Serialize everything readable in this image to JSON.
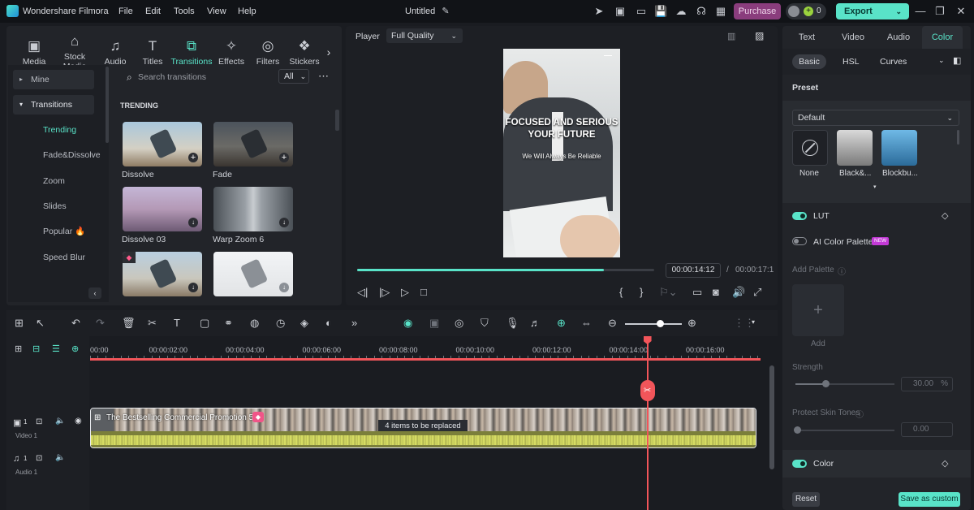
{
  "app": {
    "name": "Wondershare Filmora",
    "project": "Untitled"
  },
  "menu": [
    "File",
    "Edit",
    "Tools",
    "View",
    "Help"
  ],
  "titlebar": {
    "purchase": "Purchase",
    "credits": "0",
    "export": "Export"
  },
  "media_tabs": [
    {
      "label": "Media",
      "icon": "media-icon"
    },
    {
      "label": "Stock Media",
      "icon": "stock-media-icon"
    },
    {
      "label": "Audio",
      "icon": "audio-icon"
    },
    {
      "label": "Titles",
      "icon": "titles-icon"
    },
    {
      "label": "Transitions",
      "icon": "transitions-icon"
    },
    {
      "label": "Effects",
      "icon": "effects-icon"
    },
    {
      "label": "Filters",
      "icon": "filters-icon"
    },
    {
      "label": "Stickers",
      "icon": "stickers-icon"
    }
  ],
  "sidebar": {
    "mine": "Mine",
    "transitions": "Transitions",
    "items": [
      "Trending",
      "Fade&Dissolve",
      "Zoom",
      "Slides",
      "Popular",
      "Speed Blur"
    ]
  },
  "library": {
    "search_placeholder": "Search transitions",
    "filter": "All",
    "section": "TRENDING",
    "items": [
      {
        "label": "Dissolve"
      },
      {
        "label": "Fade"
      },
      {
        "label": "Dissolve 03"
      },
      {
        "label": "Warp Zoom 6"
      },
      {
        "label": ""
      },
      {
        "label": ""
      }
    ]
  },
  "player": {
    "label": "Player",
    "quality": "Full Quality",
    "overlay_title": "FOCUSED AND SERIOUS\nYOUR FUTURE",
    "overlay_sub": "We Will Always Be Reliable",
    "current_time": "00:00:14:12",
    "separator": "/",
    "total_time": "00:00:17:1",
    "progress": 0.83
  },
  "timeline": {
    "ruler": [
      "00:00",
      "00:00:02:00",
      "00:00:04:00",
      "00:00:06:00",
      "00:00:08:00",
      "00:00:10:00",
      "00:00:12:00",
      "00:00:14:00",
      "00:00:16:00"
    ],
    "video_track": "Video 1",
    "audio_track": "Audio 1",
    "clip_title": "The Bestselling Commercial Promotion 57",
    "replace_text": "4 items to be replaced",
    "track_num": "1",
    "playhead_fraction": 0.83
  },
  "right": {
    "tabs": [
      "Text",
      "Video",
      "Audio",
      "Color"
    ],
    "subtabs": [
      "Basic",
      "HSL",
      "Curves"
    ],
    "preset_label": "Preset",
    "preset_value": "Default",
    "presets": [
      "None",
      "Black&...",
      "Blockbu..."
    ],
    "lut": "LUT",
    "ai_palette": "AI Color Palette",
    "new_badge": "NEW",
    "add_palette": "Add Palette",
    "add": "Add",
    "strength": "Strength",
    "strength_value": "30.00",
    "strength_unit": "%",
    "skin": "Protect Skin Tones",
    "skin_value": "0.00",
    "color": "Color",
    "reset": "Reset",
    "save_custom": "Save as custom"
  },
  "colors": {
    "accent": "#59e3c8",
    "playhead": "#f2555a",
    "purchase": "#8a3d7d"
  }
}
